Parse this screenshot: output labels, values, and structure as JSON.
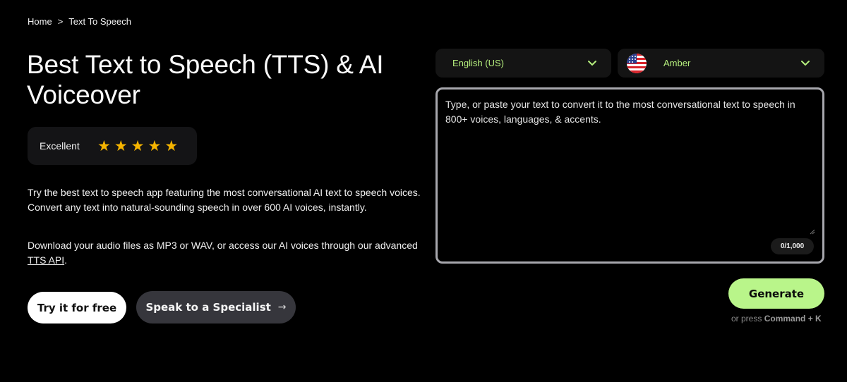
{
  "breadcrumb": {
    "items": [
      "Home",
      "Text To Speech"
    ],
    "separator": ">"
  },
  "hero": {
    "title": "Best Text to Speech (TTS) & AI Voiceover",
    "rating": {
      "label": "Excellent",
      "stars": 5,
      "star_glyph": "★",
      "star_color": "#f5b400"
    },
    "description": "Try the best text to speech app featuring the most conversational AI text to speech voices. Convert any text into natural-sounding speech in over 600 AI voices, instantly.",
    "download_text": "Download your audio files as MP3 or WAV, or access our AI voices through our advanced",
    "api_link": "TTS API",
    "download_suffix": "."
  },
  "buttons": {
    "try_free": "Try it for free",
    "specialist": "Speak to a Specialist",
    "specialist_arrow": "→"
  },
  "tts": {
    "language": {
      "value": "English (US)",
      "icon": "chevron-down-icon"
    },
    "voice": {
      "value": "Amber",
      "flag": "us-flag-icon",
      "icon": "chevron-down-icon"
    },
    "input": {
      "value": "",
      "placeholder": "Type, or paste your text to convert it to the most conversational text to speech in 800+ voices, languages, & accents."
    },
    "counter": "0/1,000",
    "generate": "Generate",
    "hint_prefix": "or press",
    "hint_shortcut": "Command + K"
  },
  "colors": {
    "accent_green": "#b9f58a",
    "select_text": "#b6f07e",
    "background": "#000000"
  }
}
